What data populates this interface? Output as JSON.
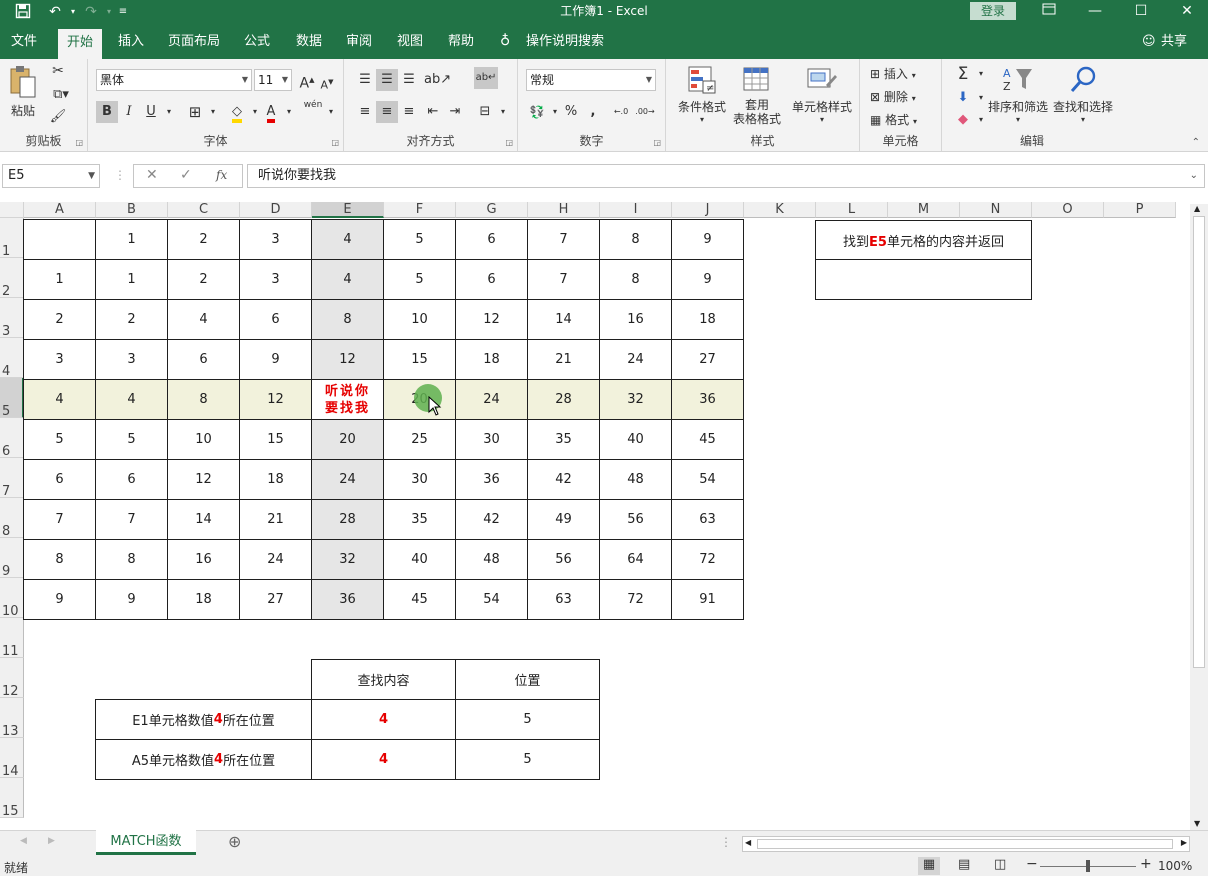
{
  "titlebar": {
    "title": "工作簿1  -  Excel",
    "login": "登录"
  },
  "menu": {
    "tabs": [
      "文件",
      "开始",
      "插入",
      "页面布局",
      "公式",
      "数据",
      "审阅",
      "视图",
      "帮助"
    ],
    "tell_me": "操作说明搜索",
    "share": "共享"
  },
  "ribbon": {
    "clipboard": {
      "label": "剪贴板",
      "paste": "粘贴"
    },
    "font": {
      "label": "字体",
      "font_name": "黑体",
      "font_size": "11",
      "bold": "B",
      "italic": "I",
      "underline": "U",
      "phonetic": "wén"
    },
    "alignment": {
      "label": "对齐方式"
    },
    "number": {
      "label": "数字",
      "format": "常规",
      "percent": "%",
      "comma": ","
    },
    "styles": {
      "label": "样式",
      "conditional": "条件格式",
      "table_line1": "套用",
      "table_line2": "表格格式",
      "cell_styles": "单元格样式"
    },
    "cells": {
      "label": "单元格",
      "insert": "插入",
      "delete": "删除",
      "format": "格式"
    },
    "editing": {
      "label": "编辑",
      "sort": "排序和筛选",
      "find": "查找和选择"
    }
  },
  "formula_bar": {
    "name_box": "E5",
    "formula": "听说你要找我"
  },
  "grid": {
    "columns": [
      "A",
      "B",
      "C",
      "D",
      "E",
      "F",
      "G",
      "H",
      "I",
      "J",
      "K",
      "L",
      "M",
      "N",
      "O",
      "P"
    ],
    "rows": [
      "1",
      "2",
      "3",
      "4",
      "5",
      "6",
      "7",
      "8",
      "9",
      "10",
      "11",
      "12",
      "13",
      "14",
      "15"
    ],
    "table": [
      [
        "",
        "1",
        "2",
        "3",
        "4",
        "5",
        "6",
        "7",
        "8",
        "9"
      ],
      [
        "1",
        "1",
        "2",
        "3",
        "4",
        "5",
        "6",
        "7",
        "8",
        "9"
      ],
      [
        "2",
        "2",
        "4",
        "6",
        "8",
        "10",
        "12",
        "14",
        "16",
        "18"
      ],
      [
        "3",
        "3",
        "6",
        "9",
        "12",
        "15",
        "18",
        "21",
        "24",
        "27"
      ],
      [
        "4",
        "4",
        "8",
        "12",
        "听说你要找我",
        "20",
        "24",
        "28",
        "32",
        "36"
      ],
      [
        "5",
        "5",
        "10",
        "15",
        "20",
        "25",
        "30",
        "35",
        "40",
        "45"
      ],
      [
        "6",
        "6",
        "12",
        "18",
        "24",
        "30",
        "36",
        "42",
        "48",
        "54"
      ],
      [
        "7",
        "7",
        "14",
        "21",
        "28",
        "35",
        "42",
        "49",
        "56",
        "63"
      ],
      [
        "8",
        "8",
        "16",
        "24",
        "32",
        "40",
        "48",
        "56",
        "64",
        "72"
      ],
      [
        "9",
        "9",
        "18",
        "27",
        "36",
        "45",
        "54",
        "63",
        "72",
        "91"
      ]
    ],
    "side_box": {
      "pre": "找到",
      "highlight": "E5",
      "post": "单元格的内容并返回",
      "result": ""
    },
    "lookup": {
      "header_content": "查找内容",
      "header_position": "位置",
      "rows": [
        {
          "pre": "E1单元格数值",
          "num": "4",
          "post": "所在位置",
          "value": "4",
          "position": "5"
        },
        {
          "pre": "A5单元格数值",
          "num": "4",
          "post": "所在位置",
          "value": "4",
          "position": "5"
        }
      ]
    }
  },
  "sheet": {
    "tab": "MATCH函数"
  },
  "status": {
    "ready": "就绪",
    "zoom": "100%"
  },
  "colors": {
    "accent": "#217346",
    "highlight_row": "#f2f2dc",
    "highlight_col": "#e6e6e6",
    "red": "#e60000",
    "cursor_dot": "#5fb04f"
  }
}
